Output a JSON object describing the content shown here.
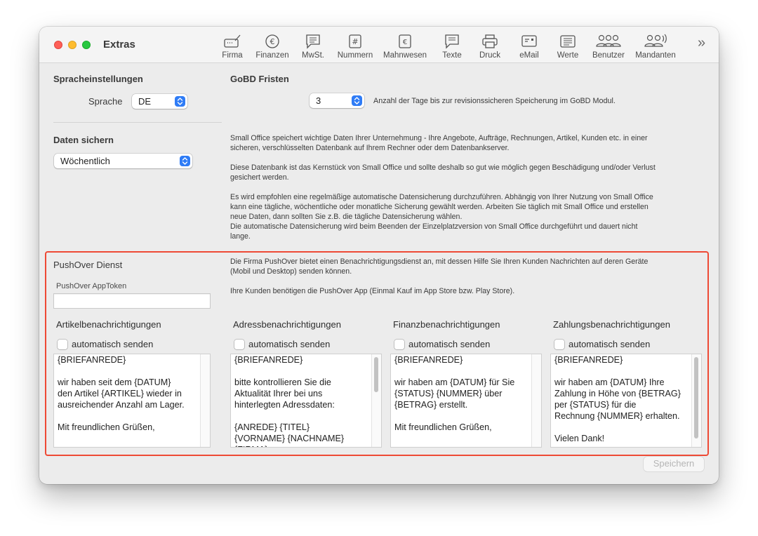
{
  "window": {
    "title": "Extras"
  },
  "toolbar": {
    "items": [
      {
        "label": "Firma",
        "icon": "firma-icon"
      },
      {
        "label": "Finanzen",
        "icon": "euro-circle-icon"
      },
      {
        "label": "MwSt.",
        "icon": "speech-bubble-icon"
      },
      {
        "label": "Nummern",
        "icon": "number-sign-icon"
      },
      {
        "label": "Mahnwesen",
        "icon": "euro-document-icon"
      },
      {
        "label": "Texte",
        "icon": "text-bubble-icon"
      },
      {
        "label": "Druck",
        "icon": "printer-icon"
      },
      {
        "label": "eMail",
        "icon": "email-card-icon"
      },
      {
        "label": "Werte",
        "icon": "list-icon"
      },
      {
        "label": "Benutzer",
        "icon": "users-icon"
      },
      {
        "label": "Mandanten",
        "icon": "clients-icon"
      }
    ],
    "more": "»"
  },
  "sprache": {
    "title": "Spracheinstellungen",
    "label": "Sprache",
    "value": "DE"
  },
  "gobd": {
    "title": "GoBD Fristen",
    "value": "3",
    "description": "Anzahl der Tage bis zur revisionssicheren Speicherung im GoBD Modul."
  },
  "backup": {
    "title": "Daten sichern",
    "value": "Wöchentlich",
    "para1_line1": "Small Office speichert wichtige Daten Ihrer Unternehmung - Ihre Angebote, Aufträge, Rechnungen, Artikel, Kunden etc. in einer",
    "para1_line2": "sicheren, verschlüsselten Datenbank auf Ihrem Rechner oder dem Datenbankserver.",
    "para2_line1": "Diese Datenbank ist das Kernstück von Small Office und sollte deshalb so gut wie möglich gegen Beschädigung und/oder Verlust",
    "para2_line2": "gesichert werden.",
    "para3_line1": "Es wird empfohlen eine regelmäßige automatische Datensicherung durchzuführen. Abhängig von Ihrer Nutzung von Small Office",
    "para3_line2": "kann eine tägliche, wöchentliche oder monatliche Sicherung gewählt werden. Arbeiten Sie täglich mit Small Office und erstellen",
    "para3_line3": "neue Daten, dann sollten Sie z.B. die tägliche Datensicherung wählen.",
    "para3_line4": "Die automatische Datensicherung wird beim Beenden der Einzelplatzversion von Small Office durchgeführt und dauert nicht",
    "para3_line5": "lange."
  },
  "pushover": {
    "title": "PushOver Dienst",
    "apptoken_label": "PushOver AppToken",
    "apptoken_value": "",
    "desc_line1": "Die Firma PushOver bietet einen Benachrichtigungsdienst an, mit dessen Hilfe Sie Ihren Kunden Nachrichten auf deren Geräte",
    "desc_line2": "(Mobil und Desktop) senden können.",
    "desc_line3": "Ihre Kunden benötigen die PushOver App (Einmal Kauf im App Store bzw. Play Store).",
    "columns": [
      {
        "title": "Artikelbenachrichtigungen",
        "checkbox_label": "automatisch senden",
        "checked": false,
        "text": "{BRIEFANREDE}\n\nwir haben seit dem {DATUM}\nden Artikel {ARTIKEL} wieder in\nausreichender Anzahl am Lager.\n\nMit freundlichen Grüßen,"
      },
      {
        "title": "Adressbenachrichtigungen",
        "checkbox_label": "automatisch senden",
        "checked": false,
        "text": "{BRIEFANREDE}\n\nbitte kontrollieren Sie die\nAktualität Ihrer bei uns\nhinterlegten Adressdaten:\n\n{ANREDE} {TITEL}\n{VORNAME} {NACHNAME}\n{FIRMA}"
      },
      {
        "title": "Finanzbenachrichtigungen",
        "checkbox_label": "automatisch senden",
        "checked": false,
        "text": "{BRIEFANREDE}\n\nwir haben am {DATUM} für Sie\n{STATUS} {NUMMER} über\n{BETRAG} erstellt.\n\nMit freundlichen Grüßen,"
      },
      {
        "title": "Zahlungsbenachrichtigungen",
        "checkbox_label": "automatisch senden",
        "checked": false,
        "text": "{BRIEFANREDE}\n\nwir haben am {DATUM} Ihre\nZahlung in Höhe von {BETRAG}\nper {STATUS} für die\nRechnung {NUMMER} erhalten.\n\nVielen Dank!"
      }
    ]
  },
  "footer": {
    "save_label": "Speichern"
  },
  "colors": {
    "accent": "#2f7cf6",
    "highlight": "#ee4a35"
  }
}
